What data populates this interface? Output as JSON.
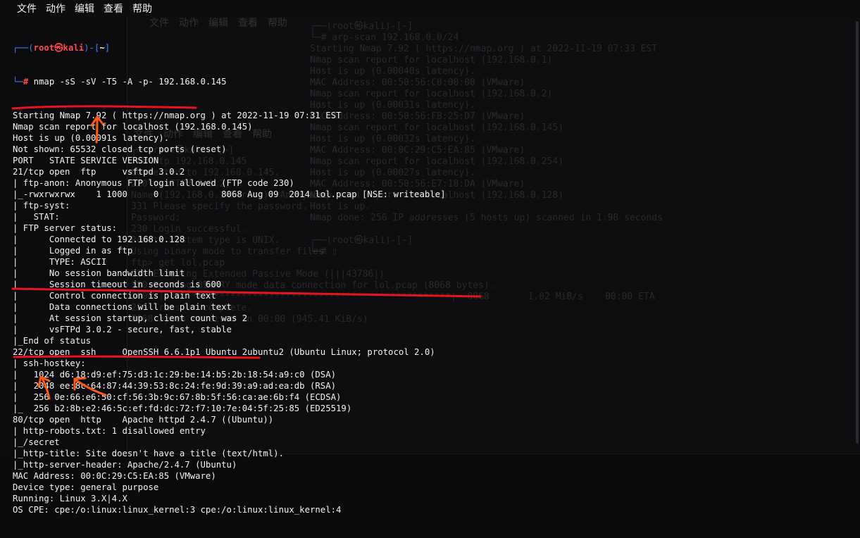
{
  "menu": [
    "文件",
    "动作",
    "编辑",
    "查看",
    "帮助"
  ],
  "prompt": {
    "corner_top": "┌──(",
    "user": "root㉿kali",
    "sep": ")-[",
    "dir": "~",
    "close": "]",
    "corner_bottom": "└─",
    "symbol": "#",
    "command": " nmap -sS -sV -T5 -A -p- 192.168.0.145"
  },
  "output": [
    "Starting Nmap 7.92 ( https://nmap.org ) at 2022-11-19 07:31 EST",
    "Nmap scan report for localhost (192.168.0.145)",
    "Host is up (0.00091s latency).",
    "Not shown: 65532 closed tcp ports (reset)",
    "PORT   STATE SERVICE VERSION",
    "21/tcp open  ftp     vsftpd 3.0.2",
    "| ftp-anon: Anonymous FTP login allowed (FTP code 230)",
    "|_-rwxrwxrwx    1 1000     0            8068 Aug 09  2014 lol.pcap [NSE: writeable]",
    "| ftp-syst: ",
    "|   STAT: ",
    "| FTP server status:",
    "|      Connected to 192.168.0.128",
    "|      Logged in as ftp",
    "|      TYPE: ASCII",
    "|      No session bandwidth limit",
    "|      Session timeout in seconds is 600",
    "|      Control connection is plain text",
    "|      Data connections will be plain text",
    "|      At session startup, client count was 2",
    "|      vsFTPd 3.0.2 - secure, fast, stable",
    "|_End of status",
    "22/tcp open  ssh     OpenSSH 6.6.1p1 Ubuntu 2ubuntu2 (Ubuntu Linux; protocol 2.0)",
    "| ssh-hostkey: ",
    "|   1024 d6:18:d9:ef:75:d3:1c:29:be:14:b5:2b:18:54:a9:c0 (DSA)",
    "|   2048 ee:8c:64:87:44:39:53:8c:24:fe:9d:39:a9:ad:ea:db (RSA)",
    "|   256 0e:66:e6:50:cf:56:3b:9c:67:8b:5f:56:ca:ae:6b:f4 (ECDSA)",
    "|_  256 b2:8b:e2:46:5c:ef:fd:dc:72:f7:10:7e:04:5f:25:85 (ED25519)",
    "80/tcp open  http    Apache httpd 2.4.7 ((Ubuntu))",
    "| http-robots.txt: 1 disallowed entry ",
    "|_/secret",
    "|_http-title: Site doesn't have a title (text/html).",
    "|_http-server-header: Apache/2.4.7 (Ubuntu)",
    "MAC Address: 00:0C:29:C5:EA:85 (VMware)",
    "Device type: general purpose",
    "Running: Linux 3.X|4.X",
    "OS CPE: cpe:/o:linux:linux_kernel:3 cpe:/o:linux:linux_kernel:4"
  ],
  "ghost_right_menu": [
    "文件",
    "动作",
    "编辑",
    "查看",
    "帮助"
  ],
  "ghost_right": [
    "┌──(root㉿kali)-[~]",
    "└─# arp-scan 192.168.0.0/24",
    "Starting Nmap 7.92 ( https://nmap.org ) at 2022-11-19 07:33 EST",
    "Nmap scan report for localhost (192.168.0.1)",
    "Host is up (0.00040s latency).",
    "MAC Address: 00:50:56:C0:00:08 (VMware)",
    "Nmap scan report for localhost (192.168.0.2)",
    "Host is up (0.00031s latency).",
    "MAC Address: 00:50:56:FB:25:D7 (VMware)",
    "Nmap scan report for localhost (192.168.0.145)",
    "Host is up (0.00032s latency).",
    "MAC Address: 00:0C:29:C5:EA:85 (VMware)",
    "Nmap scan report for localhost (192.168.0.254)",
    "Host is up (0.00027s latency).",
    "MAC Address: 00:50:56:E7:18:DA (VMware)",
    "Nmap scan report for localhost (192.168.0.128)",
    "Host is up.",
    "Nmap done: 256 IP addresses (5 hosts up) scanned in 1.98 seconds",
    "",
    "┌──(root㉿kali)-[~]",
    "└─# ▯"
  ],
  "ghost_mid_menu": [
    "文件",
    "动作",
    "编辑",
    "查看",
    "帮助"
  ],
  "ghost_mid": [
    "┌──(root㉿kali)-[~]",
    "└─# ftp 192.168.0.145",
    "Connected to 192.168.0.145.",
    "220 (vsFTPd 3.0.2)",
    "Name (192.168.0.145:root): Anonymous",
    "331 Please specify the password.",
    "Password: ",
    "230 Login successful.",
    "Remote system type is UNIX.",
    "Using binary mode to transfer files.",
    "ftp> get lol.pcap",
    "229 Entering Extended Passive Mode (|||43786|)",
    "150 Opening BINARY mode data connection for lol.pcap (8068 bytes).",
    "100% |****************************************************|  8068       1.02 MiB/s    00:00 ETA",
    "226 Transfer complete.",
    "8068 bytes received in 00:00 (945.41 KiB/s)"
  ]
}
